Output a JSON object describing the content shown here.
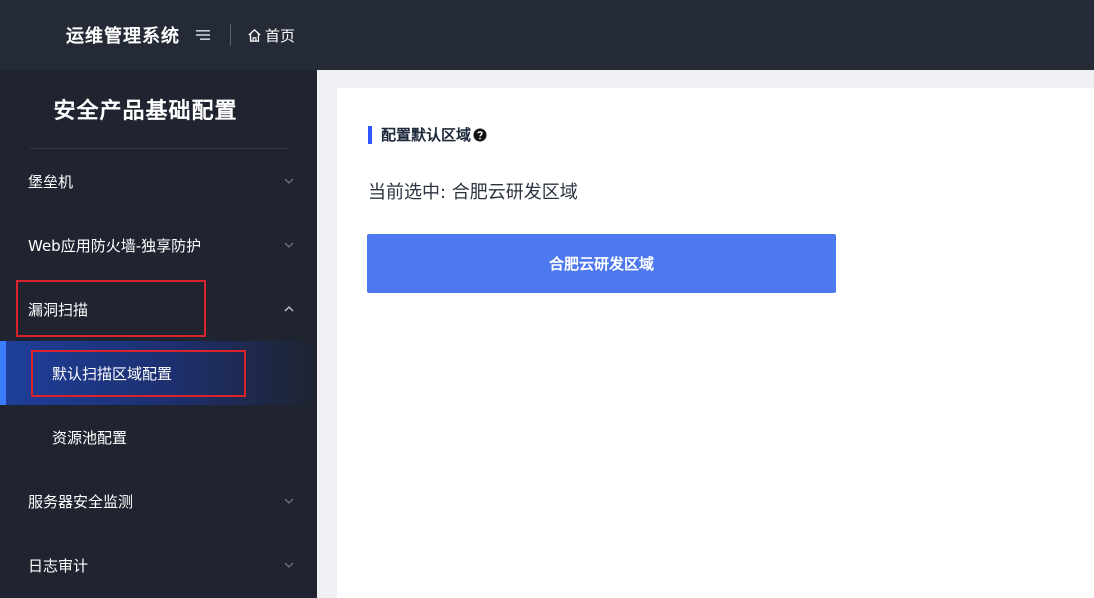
{
  "header": {
    "app_title": "运维管理系统",
    "breadcrumb_home": "首页",
    "background": "#252b36"
  },
  "sidebar": {
    "title": "安全产品基础配置",
    "items": [
      {
        "label": "堡垒机",
        "expanded": false
      },
      {
        "label": "Web应用防火墙-独享防护",
        "expanded": false
      },
      {
        "label": "漏洞扫描",
        "expanded": true,
        "children": [
          {
            "label": "默认扫描区域配置",
            "active": true
          },
          {
            "label": "资源池配置",
            "active": false
          }
        ]
      },
      {
        "label": "服务器安全监测",
        "expanded": false
      },
      {
        "label": "日志审计",
        "expanded": false
      }
    ],
    "active_color": "#3b7cff"
  },
  "main": {
    "section_title": "配置默认区域",
    "current_label": "当前选中: ",
    "current_value": "合肥云研发区域",
    "region_button": "合肥云研发区域",
    "button_color": "#4d78f0"
  }
}
